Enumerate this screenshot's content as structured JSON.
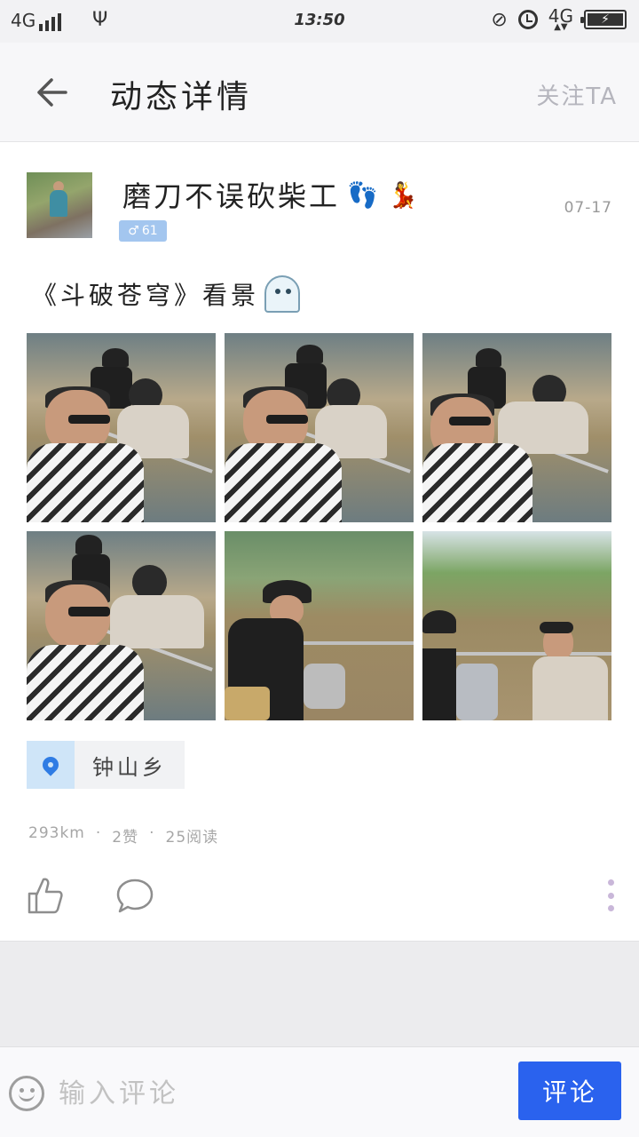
{
  "status_bar": {
    "network_left": "4G",
    "time": "13:50",
    "network_right": "4G"
  },
  "nav": {
    "title": "动态详情",
    "follow_label": "关注TA"
  },
  "post": {
    "username": "磨刀不误砍柴工",
    "emoji_feet": "👣",
    "emoji_dancer": "💃",
    "gender_symbol": "♂",
    "age": "61",
    "date": "07-17",
    "text": "《斗破苍穹》看景",
    "location": "钟山乡",
    "distance": "293km",
    "likes": "2赞",
    "reads": "25阅读",
    "meta_sep": "·"
  },
  "comment_bar": {
    "placeholder": "输入评论",
    "button_label": "评论"
  },
  "icons": {
    "back": "back-arrow-icon",
    "like": "thumbs-up-icon",
    "comment": "speech-bubble-icon",
    "more": "more-vertical-icon",
    "location": "map-pin-icon",
    "emoji": "smile-icon"
  },
  "colors": {
    "accent": "#2a62ee",
    "follow_text": "#b5b5bd",
    "meta_text": "#a6a6a6",
    "gender_badge": "#a3c6ef"
  }
}
